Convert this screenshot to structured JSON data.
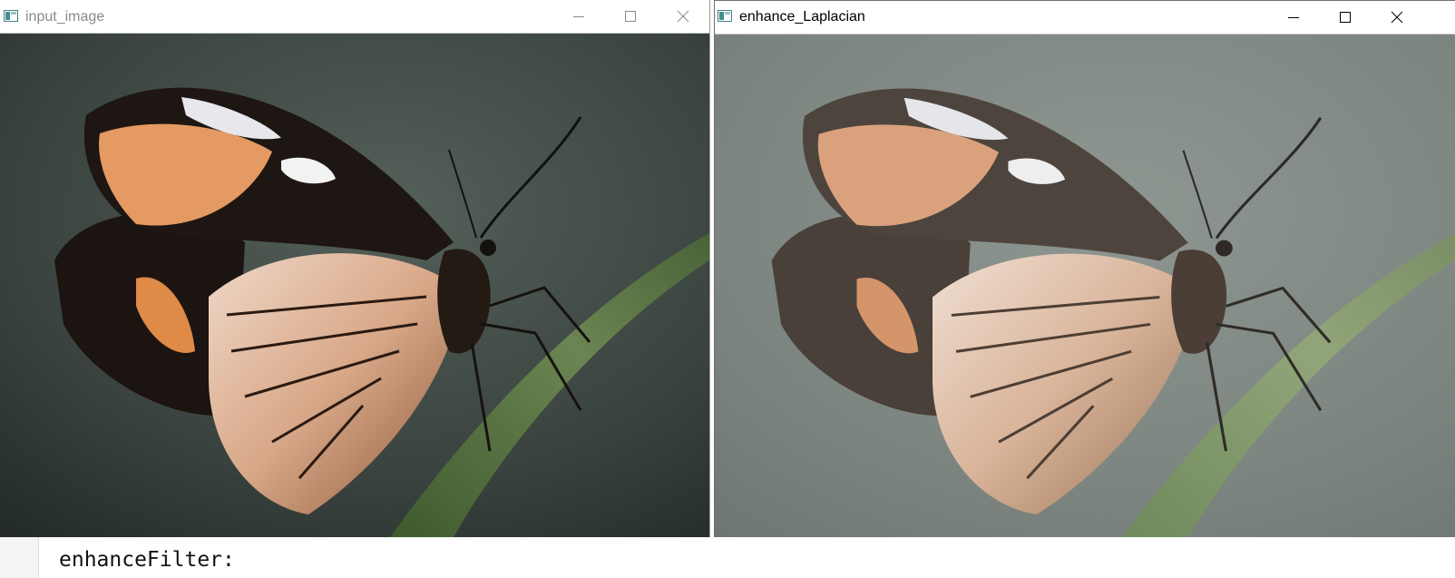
{
  "windows": [
    {
      "title": "input_image",
      "active": false,
      "buttons": [
        "minimize",
        "maximize",
        "close"
      ],
      "content": "butterfly-photo"
    },
    {
      "title": "enhance_Laplacian",
      "active": true,
      "buttons": [
        "minimize",
        "maximize",
        "close"
      ],
      "content": "butterfly-photo-enhanced"
    }
  ],
  "editor": {
    "code_line": "enhanceFilter:"
  },
  "icons": {
    "window_app": "opencv-window-icon",
    "minimize": "minimize-icon",
    "maximize": "maximize-icon",
    "close": "close-icon"
  },
  "colors": {
    "inactive_title": "#8a8a8a",
    "active_title": "#000000",
    "icon_teal": "#3f8f8f"
  }
}
